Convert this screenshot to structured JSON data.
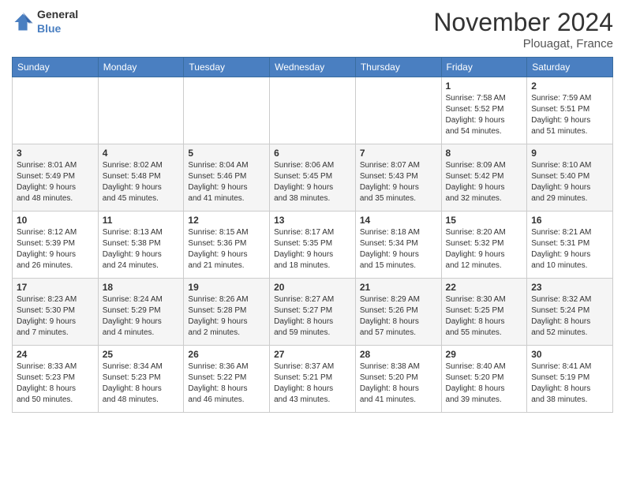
{
  "logo": {
    "general": "General",
    "blue": "Blue"
  },
  "header": {
    "month": "November 2024",
    "location": "Plouagat, France"
  },
  "weekdays": [
    "Sunday",
    "Monday",
    "Tuesday",
    "Wednesday",
    "Thursday",
    "Friday",
    "Saturday"
  ],
  "weeks": [
    [
      {
        "day": "",
        "info": ""
      },
      {
        "day": "",
        "info": ""
      },
      {
        "day": "",
        "info": ""
      },
      {
        "day": "",
        "info": ""
      },
      {
        "day": "",
        "info": ""
      },
      {
        "day": "1",
        "info": "Sunrise: 7:58 AM\nSunset: 5:52 PM\nDaylight: 9 hours\nand 54 minutes."
      },
      {
        "day": "2",
        "info": "Sunrise: 7:59 AM\nSunset: 5:51 PM\nDaylight: 9 hours\nand 51 minutes."
      }
    ],
    [
      {
        "day": "3",
        "info": "Sunrise: 8:01 AM\nSunset: 5:49 PM\nDaylight: 9 hours\nand 48 minutes."
      },
      {
        "day": "4",
        "info": "Sunrise: 8:02 AM\nSunset: 5:48 PM\nDaylight: 9 hours\nand 45 minutes."
      },
      {
        "day": "5",
        "info": "Sunrise: 8:04 AM\nSunset: 5:46 PM\nDaylight: 9 hours\nand 41 minutes."
      },
      {
        "day": "6",
        "info": "Sunrise: 8:06 AM\nSunset: 5:45 PM\nDaylight: 9 hours\nand 38 minutes."
      },
      {
        "day": "7",
        "info": "Sunrise: 8:07 AM\nSunset: 5:43 PM\nDaylight: 9 hours\nand 35 minutes."
      },
      {
        "day": "8",
        "info": "Sunrise: 8:09 AM\nSunset: 5:42 PM\nDaylight: 9 hours\nand 32 minutes."
      },
      {
        "day": "9",
        "info": "Sunrise: 8:10 AM\nSunset: 5:40 PM\nDaylight: 9 hours\nand 29 minutes."
      }
    ],
    [
      {
        "day": "10",
        "info": "Sunrise: 8:12 AM\nSunset: 5:39 PM\nDaylight: 9 hours\nand 26 minutes."
      },
      {
        "day": "11",
        "info": "Sunrise: 8:13 AM\nSunset: 5:38 PM\nDaylight: 9 hours\nand 24 minutes."
      },
      {
        "day": "12",
        "info": "Sunrise: 8:15 AM\nSunset: 5:36 PM\nDaylight: 9 hours\nand 21 minutes."
      },
      {
        "day": "13",
        "info": "Sunrise: 8:17 AM\nSunset: 5:35 PM\nDaylight: 9 hours\nand 18 minutes."
      },
      {
        "day": "14",
        "info": "Sunrise: 8:18 AM\nSunset: 5:34 PM\nDaylight: 9 hours\nand 15 minutes."
      },
      {
        "day": "15",
        "info": "Sunrise: 8:20 AM\nSunset: 5:32 PM\nDaylight: 9 hours\nand 12 minutes."
      },
      {
        "day": "16",
        "info": "Sunrise: 8:21 AM\nSunset: 5:31 PM\nDaylight: 9 hours\nand 10 minutes."
      }
    ],
    [
      {
        "day": "17",
        "info": "Sunrise: 8:23 AM\nSunset: 5:30 PM\nDaylight: 9 hours\nand 7 minutes."
      },
      {
        "day": "18",
        "info": "Sunrise: 8:24 AM\nSunset: 5:29 PM\nDaylight: 9 hours\nand 4 minutes."
      },
      {
        "day": "19",
        "info": "Sunrise: 8:26 AM\nSunset: 5:28 PM\nDaylight: 9 hours\nand 2 minutes."
      },
      {
        "day": "20",
        "info": "Sunrise: 8:27 AM\nSunset: 5:27 PM\nDaylight: 8 hours\nand 59 minutes."
      },
      {
        "day": "21",
        "info": "Sunrise: 8:29 AM\nSunset: 5:26 PM\nDaylight: 8 hours\nand 57 minutes."
      },
      {
        "day": "22",
        "info": "Sunrise: 8:30 AM\nSunset: 5:25 PM\nDaylight: 8 hours\nand 55 minutes."
      },
      {
        "day": "23",
        "info": "Sunrise: 8:32 AM\nSunset: 5:24 PM\nDaylight: 8 hours\nand 52 minutes."
      }
    ],
    [
      {
        "day": "24",
        "info": "Sunrise: 8:33 AM\nSunset: 5:23 PM\nDaylight: 8 hours\nand 50 minutes."
      },
      {
        "day": "25",
        "info": "Sunrise: 8:34 AM\nSunset: 5:23 PM\nDaylight: 8 hours\nand 48 minutes."
      },
      {
        "day": "26",
        "info": "Sunrise: 8:36 AM\nSunset: 5:22 PM\nDaylight: 8 hours\nand 46 minutes."
      },
      {
        "day": "27",
        "info": "Sunrise: 8:37 AM\nSunset: 5:21 PM\nDaylight: 8 hours\nand 43 minutes."
      },
      {
        "day": "28",
        "info": "Sunrise: 8:38 AM\nSunset: 5:20 PM\nDaylight: 8 hours\nand 41 minutes."
      },
      {
        "day": "29",
        "info": "Sunrise: 8:40 AM\nSunset: 5:20 PM\nDaylight: 8 hours\nand 39 minutes."
      },
      {
        "day": "30",
        "info": "Sunrise: 8:41 AM\nSunset: 5:19 PM\nDaylight: 8 hours\nand 38 minutes."
      }
    ]
  ]
}
